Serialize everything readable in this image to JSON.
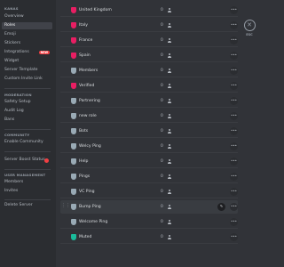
{
  "sidebar": {
    "server_section_title": "KANAS",
    "server_items": [
      {
        "label": "Overview"
      },
      {
        "label": "Roles",
        "active": true
      },
      {
        "label": "Emoji"
      },
      {
        "label": "Stickers"
      },
      {
        "label": "Integrations",
        "badge": "NEW"
      },
      {
        "label": "Widget"
      },
      {
        "label": "Server Template"
      },
      {
        "label": "Custom Invite Link"
      }
    ],
    "moderation_section_title": "MODERATION",
    "moderation_items": [
      {
        "label": "Safety Setup"
      },
      {
        "label": "Audit Log"
      },
      {
        "label": "Bans"
      }
    ],
    "community_section_title": "COMMUNITY",
    "community_items": [
      {
        "label": "Enable Community"
      }
    ],
    "boost_item": {
      "label": "Server Boost Status"
    },
    "user_mgmt_section_title": "USER MANAGEMENT",
    "user_mgmt_items": [
      {
        "label": "Members"
      },
      {
        "label": "Invites"
      }
    ],
    "delete_item": {
      "label": "Delete Server"
    }
  },
  "roles": [
    {
      "name": "United Kingdom",
      "count": "0",
      "color": "#e91e63"
    },
    {
      "name": "Italy",
      "count": "0",
      "color": "#e91e63"
    },
    {
      "name": "France",
      "count": "0",
      "color": "#e91e63"
    },
    {
      "name": "Spain",
      "count": "0",
      "color": "#e91e63"
    },
    {
      "name": "Members",
      "count": "0",
      "color": "#99aab5"
    },
    {
      "name": "Verified",
      "count": "0",
      "color": "#e91e63"
    },
    {
      "name": "Partnering",
      "count": "0",
      "color": "#99aab5"
    },
    {
      "name": "new role",
      "count": "0",
      "color": "#99aab5"
    },
    {
      "name": "Bots",
      "count": "0",
      "color": "#99aab5"
    },
    {
      "name": "Welcy Ping",
      "count": "0",
      "color": "#99aab5"
    },
    {
      "name": "Help",
      "count": "0",
      "color": "#99aab5"
    },
    {
      "name": "Pings",
      "count": "0",
      "color": "#99aab5"
    },
    {
      "name": "VC Ping",
      "count": "0",
      "color": "#99aab5"
    },
    {
      "name": "Bump Ping",
      "count": "0",
      "color": "#99aab5"
    },
    {
      "name": "Welcome Ping",
      "count": "0",
      "color": "#99aab5"
    },
    {
      "name": "Muted",
      "count": "0",
      "color": "#1abc9c"
    }
  ],
  "close": {
    "icon": "close-icon",
    "label": "ESC"
  },
  "colors": {
    "accent_red": "#f23f43",
    "background": "#313338",
    "sidebar": "#2b2d31"
  }
}
